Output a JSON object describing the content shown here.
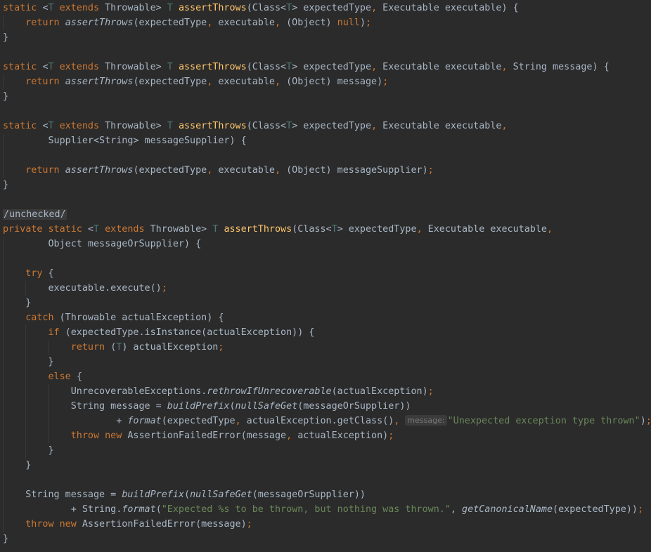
{
  "theme": {
    "background": "#2b2b2b",
    "keyword": "#cc7832",
    "method_declaration": "#ffc66d",
    "type_parameter": "#507874",
    "string": "#6a8759",
    "default_text": "#a9b7c6",
    "inlay_hint": "#787878"
  },
  "code": {
    "lines": [
      [
        {
          "t": "static ",
          "c": "kw"
        },
        {
          "t": "<"
        },
        {
          "t": "T",
          "c": "tp"
        },
        {
          "t": " "
        },
        {
          "t": "extends",
          "c": "kw"
        },
        {
          "t": " Throwable> "
        },
        {
          "t": "T",
          "c": "tp"
        },
        {
          "t": " "
        },
        {
          "t": "assertThrows",
          "c": "fn"
        },
        {
          "t": "(Class<"
        },
        {
          "t": "T",
          "c": "tp"
        },
        {
          "t": "> expectedType"
        },
        {
          "t": ",",
          "c": "pu"
        },
        {
          "t": " Executable executable) {"
        }
      ],
      [
        {
          "t": "    "
        },
        {
          "t": "return ",
          "c": "kw"
        },
        {
          "t": "assertThrows",
          "c": "it"
        },
        {
          "t": "(expectedType"
        },
        {
          "t": ",",
          "c": "pu"
        },
        {
          "t": " executable"
        },
        {
          "t": ",",
          "c": "pu"
        },
        {
          "t": " (Object) "
        },
        {
          "t": "null",
          "c": "kw"
        },
        {
          "t": ")"
        },
        {
          "t": ";",
          "c": "pu"
        }
      ],
      [
        {
          "t": "}"
        }
      ],
      [],
      [
        {
          "t": "static ",
          "c": "kw"
        },
        {
          "t": "<"
        },
        {
          "t": "T",
          "c": "tp"
        },
        {
          "t": " "
        },
        {
          "t": "extends",
          "c": "kw"
        },
        {
          "t": " Throwable> "
        },
        {
          "t": "T",
          "c": "tp"
        },
        {
          "t": " "
        },
        {
          "t": "assertThrows",
          "c": "fn"
        },
        {
          "t": "(Class<"
        },
        {
          "t": "T",
          "c": "tp"
        },
        {
          "t": "> expectedType"
        },
        {
          "t": ",",
          "c": "pu"
        },
        {
          "t": " Executable executable"
        },
        {
          "t": ",",
          "c": "pu"
        },
        {
          "t": " String message) {"
        }
      ],
      [
        {
          "t": "    "
        },
        {
          "t": "return ",
          "c": "kw"
        },
        {
          "t": "assertThrows",
          "c": "it"
        },
        {
          "t": "(expectedType"
        },
        {
          "t": ",",
          "c": "pu"
        },
        {
          "t": " executable"
        },
        {
          "t": ",",
          "c": "pu"
        },
        {
          "t": " (Object) message)"
        },
        {
          "t": ";",
          "c": "pu"
        }
      ],
      [
        {
          "t": "}"
        }
      ],
      [],
      [
        {
          "t": "static ",
          "c": "kw"
        },
        {
          "t": "<"
        },
        {
          "t": "T",
          "c": "tp"
        },
        {
          "t": " "
        },
        {
          "t": "extends",
          "c": "kw"
        },
        {
          "t": " Throwable> "
        },
        {
          "t": "T",
          "c": "tp"
        },
        {
          "t": " "
        },
        {
          "t": "assertThrows",
          "c": "fn"
        },
        {
          "t": "(Class<"
        },
        {
          "t": "T",
          "c": "tp"
        },
        {
          "t": "> expectedType"
        },
        {
          "t": ",",
          "c": "pu"
        },
        {
          "t": " Executable executable"
        },
        {
          "t": ",",
          "c": "pu"
        }
      ],
      [
        {
          "t": "        Supplier<String> messageSupplier) {"
        }
      ],
      [],
      [
        {
          "t": "    "
        },
        {
          "t": "return ",
          "c": "kw"
        },
        {
          "t": "assertThrows",
          "c": "it"
        },
        {
          "t": "(expectedType"
        },
        {
          "t": ",",
          "c": "pu"
        },
        {
          "t": " executable"
        },
        {
          "t": ",",
          "c": "pu"
        },
        {
          "t": " (Object) messageSupplier)"
        },
        {
          "t": ";",
          "c": "pu"
        }
      ],
      [
        {
          "t": "}"
        }
      ],
      [],
      [
        {
          "t": "/unchecked/",
          "c": "ann"
        }
      ],
      [
        {
          "t": "private static ",
          "c": "kw"
        },
        {
          "t": "<"
        },
        {
          "t": "T",
          "c": "tp"
        },
        {
          "t": " "
        },
        {
          "t": "extends",
          "c": "kw"
        },
        {
          "t": " Throwable> "
        },
        {
          "t": "T",
          "c": "tp"
        },
        {
          "t": " "
        },
        {
          "t": "assertThrows",
          "c": "fn"
        },
        {
          "t": "(Class<"
        },
        {
          "t": "T",
          "c": "tp"
        },
        {
          "t": "> expectedType"
        },
        {
          "t": ",",
          "c": "pu"
        },
        {
          "t": " Executable executable"
        },
        {
          "t": ",",
          "c": "pu"
        }
      ],
      [
        {
          "t": "        Object messageOrSupplier) {"
        }
      ],
      [],
      [
        {
          "t": "    "
        },
        {
          "t": "try ",
          "c": "kw"
        },
        {
          "t": "{"
        }
      ],
      [
        {
          "t": "        executable.execute()"
        },
        {
          "t": ";",
          "c": "pu"
        }
      ],
      [
        {
          "t": "    }"
        }
      ],
      [
        {
          "t": "    "
        },
        {
          "t": "catch ",
          "c": "kw"
        },
        {
          "t": "(Throwable actualException) {"
        }
      ],
      [
        {
          "t": "        "
        },
        {
          "t": "if ",
          "c": "kw"
        },
        {
          "t": "(expectedType.isInstance(actualException)) {"
        }
      ],
      [
        {
          "t": "            "
        },
        {
          "t": "return ",
          "c": "kw"
        },
        {
          "t": "("
        },
        {
          "t": "T",
          "c": "tp"
        },
        {
          "t": ") actualException"
        },
        {
          "t": ";",
          "c": "pu"
        }
      ],
      [
        {
          "t": "        }"
        }
      ],
      [
        {
          "t": "        "
        },
        {
          "t": "else ",
          "c": "kw"
        },
        {
          "t": "{"
        }
      ],
      [
        {
          "t": "            UnrecoverableExceptions."
        },
        {
          "t": "rethrowIfUnrecoverable",
          "c": "it"
        },
        {
          "t": "(actualException)"
        },
        {
          "t": ";",
          "c": "pu"
        }
      ],
      [
        {
          "t": "            String message = "
        },
        {
          "t": "buildPrefix",
          "c": "it"
        },
        {
          "t": "("
        },
        {
          "t": "nullSafeGet",
          "c": "it"
        },
        {
          "t": "(messageOrSupplier))"
        }
      ],
      [
        {
          "t": "                    + "
        },
        {
          "t": "format",
          "c": "it"
        },
        {
          "t": "(expectedType"
        },
        {
          "t": ",",
          "c": "pu"
        },
        {
          "t": " actualException.getClass()"
        },
        {
          "t": ",",
          "c": "pu"
        },
        {
          "t": " "
        },
        {
          "t": "message:",
          "c": "hint"
        },
        {
          "t": "\"Unexpected exception type thrown\"",
          "c": "str"
        },
        {
          "t": ")"
        },
        {
          "t": ";",
          "c": "pu"
        }
      ],
      [
        {
          "t": "            "
        },
        {
          "t": "throw new ",
          "c": "kw"
        },
        {
          "t": "AssertionFailedError(message"
        },
        {
          "t": ",",
          "c": "pu"
        },
        {
          "t": " actualException)"
        },
        {
          "t": ";",
          "c": "pu"
        }
      ],
      [
        {
          "t": "        }"
        }
      ],
      [
        {
          "t": "    }"
        }
      ],
      [],
      [
        {
          "t": "    String message = "
        },
        {
          "t": "buildPrefix",
          "c": "it"
        },
        {
          "t": "("
        },
        {
          "t": "nullSafeGet",
          "c": "it"
        },
        {
          "t": "(messageOrSupplier))"
        }
      ],
      [
        {
          "t": "            + String."
        },
        {
          "t": "format",
          "c": "it"
        },
        {
          "t": "("
        },
        {
          "t": "\"Expected %s to be thrown, but nothing was thrown.\"",
          "c": "str"
        },
        {
          "t": ","
        },
        {
          "t": " "
        },
        {
          "t": "getCanonicalName",
          "c": "it"
        },
        {
          "t": "(expectedType))"
        },
        {
          "t": ";",
          "c": "pu"
        }
      ],
      [
        {
          "t": "    "
        },
        {
          "t": "throw new ",
          "c": "kw"
        },
        {
          "t": "AssertionFailedError(message)"
        },
        {
          "t": ";",
          "c": "pu"
        }
      ],
      [
        {
          "t": "}"
        }
      ]
    ]
  }
}
